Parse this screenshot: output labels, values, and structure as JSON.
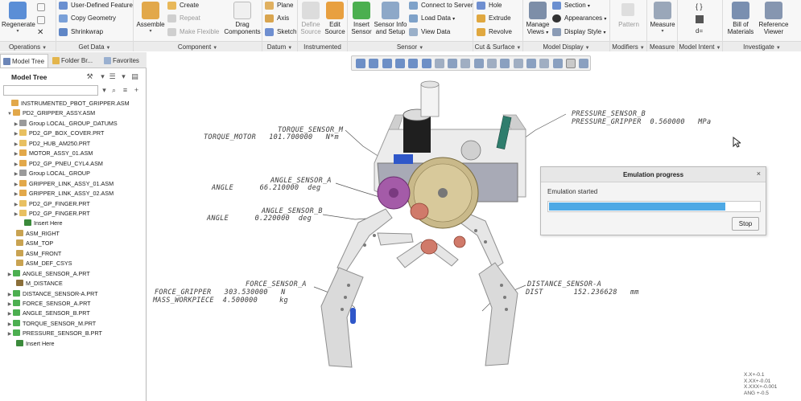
{
  "ribbon": {
    "groups": [
      {
        "label": "Operations"
      },
      {
        "label": "Get Data"
      },
      {
        "label": "Component"
      },
      {
        "label": "Datum"
      },
      {
        "label": "Instrumented"
      },
      {
        "label": "Sensor"
      },
      {
        "label": "Cut & Surface"
      },
      {
        "label": "Model Display"
      },
      {
        "label": "Modifiers"
      },
      {
        "label": "Measure"
      },
      {
        "label": "Model Intent"
      },
      {
        "label": "Investigate"
      }
    ],
    "regenerate": "Regenerate",
    "user_defined_feature": "User-Defined Feature",
    "copy_geometry": "Copy Geometry",
    "shrinkwrap": "Shrinkwrap",
    "assemble": "Assemble",
    "create": "Create",
    "repeat": "Repeat",
    "make_flexible": "Make Flexible",
    "drag_components_1": "Drag",
    "drag_components_2": "Components",
    "plane": "Plane",
    "axis": "Axis",
    "sketch": "Sketch",
    "define_source_1": "Define",
    "define_source_2": "Source",
    "edit_source_1": "Edit",
    "edit_source_2": "Source",
    "insert_sensor_1": "Insert",
    "insert_sensor_2": "Sensor",
    "sensor_info_1": "Sensor Info",
    "sensor_info_2": "and Setup",
    "connect_to_server": "Connect to Server",
    "load_data": "Load Data",
    "view_data": "View Data",
    "hole": "Hole",
    "extrude": "Extrude",
    "revolve": "Revolve",
    "manage_views_1": "Manage",
    "manage_views_2": "Views",
    "section": "Section",
    "appearances": "Appearances",
    "display_style": "Display Style",
    "pattern": "Pattern",
    "measure": "Measure",
    "bill_of_materials_1": "Bill of",
    "bill_of_materials_2": "Materials",
    "reference_viewer_1": "Reference",
    "reference_viewer_2": "Viewer"
  },
  "panel": {
    "tabs": [
      "Model Tree",
      "Folder Br...",
      "Favorites"
    ],
    "tree_title": "Model Tree",
    "search_value": ""
  },
  "tree": [
    {
      "label": "INSTRUMENTED_PBOT_GRIPPER.ASM",
      "expander": ""
    },
    {
      "label": "PD2_GRIPPER_ASSY.ASM",
      "expander": "▼"
    },
    {
      "label": "Group LOCAL_GROUP_DATUMS",
      "expander": "▶"
    },
    {
      "label": "PD2_GP_BOX_COVER.PRT",
      "expander": "▶"
    },
    {
      "label": "PD2_HUB_AM250.PRT",
      "expander": "▶"
    },
    {
      "label": "MOTOR_ASSY_01.ASM",
      "expander": "▶"
    },
    {
      "label": "PD2_GP_PNEU_CYL4.ASM",
      "expander": "▶"
    },
    {
      "label": "Group LOCAL_GROUP",
      "expander": "▶"
    },
    {
      "label": "GRIPPER_LINK_ASSY_01.ASM",
      "expander": "▶"
    },
    {
      "label": "GRIPPER_LINK_ASSY_02.ASM",
      "expander": "▶"
    },
    {
      "label": "PD2_GP_FINGER.PRT",
      "expander": "▶"
    },
    {
      "label": "PD2_GP_FINGER.PRT",
      "expander": "▶"
    },
    {
      "label": "Insert Here",
      "expander": ""
    },
    {
      "label": "ASM_RIGHT",
      "expander": ""
    },
    {
      "label": "ASM_TOP",
      "expander": ""
    },
    {
      "label": "ASM_FRONT",
      "expander": ""
    },
    {
      "label": "ASM_DEF_CSYS",
      "expander": ""
    },
    {
      "label": "ANGLE_SENSOR_A.PRT",
      "expander": "▶"
    },
    {
      "label": "M_DISTANCE",
      "expander": ""
    },
    {
      "label": "DISTANCE_SENSOR-A.PRT",
      "expander": "▶"
    },
    {
      "label": "FORCE_SENSOR_A.PRT",
      "expander": "▶"
    },
    {
      "label": "ANGLE_SENSOR_B.PRT",
      "expander": "▶"
    },
    {
      "label": "TORQUE_SENSOR_M.PRT",
      "expander": "▶"
    },
    {
      "label": "PRESSURE_SENSOR_B.PRT",
      "expander": "▶"
    },
    {
      "label": "Insert Here",
      "expander": ""
    }
  ],
  "sensors": {
    "torque": {
      "name": "TORQUE_SENSOR_M",
      "readout": "TORQUE_MOTOR   101.700000   N*m"
    },
    "pressure": {
      "name": "PRESSURE_SENSOR_B",
      "readout": "PRESSURE_GRIPPER  0.560000   MPa"
    },
    "angle_a": {
      "name": "ANGLE_SENSOR_A",
      "readout": "ANGLE      66.210000  deg"
    },
    "angle_b": {
      "name": "ANGLE_SENSOR_B",
      "readout": "ANGLE      0.220000  deg"
    },
    "force": {
      "name": "FORCE_SENSOR_A",
      "readout1": "FORCE_GRIPPER   303.530000   N",
      "readout2": "MASS_WORKPIECE  4.500000     kg"
    },
    "distance": {
      "name": "DISTANCE_SENSOR-A",
      "readout": "DIST       152.236628   mm"
    }
  },
  "dialog": {
    "title": "Emulation progress",
    "close": "×",
    "status": "Emulation started",
    "progress_fraction": 0.84,
    "stop": "Stop"
  },
  "tolerance": {
    "line1": "X.X+-0.1",
    "line2": "X.XX+-0.01",
    "line3": "X.XXX+-0.001",
    "line4": "ANG +-0.5"
  },
  "colors": {
    "accent": "#4ea9e5",
    "gear": "#c9b98a",
    "pink_gear": "#a45ba8",
    "red_knob": "#d07a6a",
    "frame": "#dedede",
    "box": "#a8aab6",
    "blue_part": "#2f57c9"
  }
}
